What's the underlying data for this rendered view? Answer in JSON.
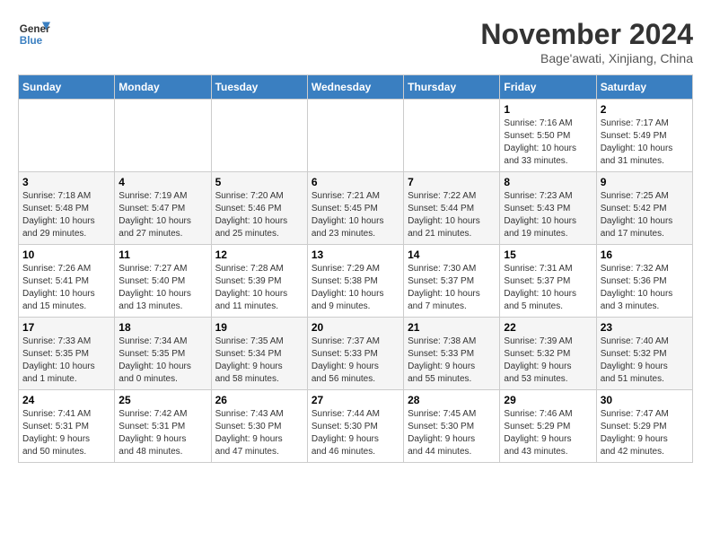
{
  "header": {
    "logo_line1": "General",
    "logo_line2": "Blue",
    "month_title": "November 2024",
    "location": "Bage'awati, Xinjiang, China"
  },
  "weekdays": [
    "Sunday",
    "Monday",
    "Tuesday",
    "Wednesday",
    "Thursday",
    "Friday",
    "Saturday"
  ],
  "weeks": [
    [
      {
        "day": "",
        "info": ""
      },
      {
        "day": "",
        "info": ""
      },
      {
        "day": "",
        "info": ""
      },
      {
        "day": "",
        "info": ""
      },
      {
        "day": "",
        "info": ""
      },
      {
        "day": "1",
        "info": "Sunrise: 7:16 AM\nSunset: 5:50 PM\nDaylight: 10 hours\nand 33 minutes."
      },
      {
        "day": "2",
        "info": "Sunrise: 7:17 AM\nSunset: 5:49 PM\nDaylight: 10 hours\nand 31 minutes."
      }
    ],
    [
      {
        "day": "3",
        "info": "Sunrise: 7:18 AM\nSunset: 5:48 PM\nDaylight: 10 hours\nand 29 minutes."
      },
      {
        "day": "4",
        "info": "Sunrise: 7:19 AM\nSunset: 5:47 PM\nDaylight: 10 hours\nand 27 minutes."
      },
      {
        "day": "5",
        "info": "Sunrise: 7:20 AM\nSunset: 5:46 PM\nDaylight: 10 hours\nand 25 minutes."
      },
      {
        "day": "6",
        "info": "Sunrise: 7:21 AM\nSunset: 5:45 PM\nDaylight: 10 hours\nand 23 minutes."
      },
      {
        "day": "7",
        "info": "Sunrise: 7:22 AM\nSunset: 5:44 PM\nDaylight: 10 hours\nand 21 minutes."
      },
      {
        "day": "8",
        "info": "Sunrise: 7:23 AM\nSunset: 5:43 PM\nDaylight: 10 hours\nand 19 minutes."
      },
      {
        "day": "9",
        "info": "Sunrise: 7:25 AM\nSunset: 5:42 PM\nDaylight: 10 hours\nand 17 minutes."
      }
    ],
    [
      {
        "day": "10",
        "info": "Sunrise: 7:26 AM\nSunset: 5:41 PM\nDaylight: 10 hours\nand 15 minutes."
      },
      {
        "day": "11",
        "info": "Sunrise: 7:27 AM\nSunset: 5:40 PM\nDaylight: 10 hours\nand 13 minutes."
      },
      {
        "day": "12",
        "info": "Sunrise: 7:28 AM\nSunset: 5:39 PM\nDaylight: 10 hours\nand 11 minutes."
      },
      {
        "day": "13",
        "info": "Sunrise: 7:29 AM\nSunset: 5:38 PM\nDaylight: 10 hours\nand 9 minutes."
      },
      {
        "day": "14",
        "info": "Sunrise: 7:30 AM\nSunset: 5:37 PM\nDaylight: 10 hours\nand 7 minutes."
      },
      {
        "day": "15",
        "info": "Sunrise: 7:31 AM\nSunset: 5:37 PM\nDaylight: 10 hours\nand 5 minutes."
      },
      {
        "day": "16",
        "info": "Sunrise: 7:32 AM\nSunset: 5:36 PM\nDaylight: 10 hours\nand 3 minutes."
      }
    ],
    [
      {
        "day": "17",
        "info": "Sunrise: 7:33 AM\nSunset: 5:35 PM\nDaylight: 10 hours\nand 1 minute."
      },
      {
        "day": "18",
        "info": "Sunrise: 7:34 AM\nSunset: 5:35 PM\nDaylight: 10 hours\nand 0 minutes."
      },
      {
        "day": "19",
        "info": "Sunrise: 7:35 AM\nSunset: 5:34 PM\nDaylight: 9 hours\nand 58 minutes."
      },
      {
        "day": "20",
        "info": "Sunrise: 7:37 AM\nSunset: 5:33 PM\nDaylight: 9 hours\nand 56 minutes."
      },
      {
        "day": "21",
        "info": "Sunrise: 7:38 AM\nSunset: 5:33 PM\nDaylight: 9 hours\nand 55 minutes."
      },
      {
        "day": "22",
        "info": "Sunrise: 7:39 AM\nSunset: 5:32 PM\nDaylight: 9 hours\nand 53 minutes."
      },
      {
        "day": "23",
        "info": "Sunrise: 7:40 AM\nSunset: 5:32 PM\nDaylight: 9 hours\nand 51 minutes."
      }
    ],
    [
      {
        "day": "24",
        "info": "Sunrise: 7:41 AM\nSunset: 5:31 PM\nDaylight: 9 hours\nand 50 minutes."
      },
      {
        "day": "25",
        "info": "Sunrise: 7:42 AM\nSunset: 5:31 PM\nDaylight: 9 hours\nand 48 minutes."
      },
      {
        "day": "26",
        "info": "Sunrise: 7:43 AM\nSunset: 5:30 PM\nDaylight: 9 hours\nand 47 minutes."
      },
      {
        "day": "27",
        "info": "Sunrise: 7:44 AM\nSunset: 5:30 PM\nDaylight: 9 hours\nand 46 minutes."
      },
      {
        "day": "28",
        "info": "Sunrise: 7:45 AM\nSunset: 5:30 PM\nDaylight: 9 hours\nand 44 minutes."
      },
      {
        "day": "29",
        "info": "Sunrise: 7:46 AM\nSunset: 5:29 PM\nDaylight: 9 hours\nand 43 minutes."
      },
      {
        "day": "30",
        "info": "Sunrise: 7:47 AM\nSunset: 5:29 PM\nDaylight: 9 hours\nand 42 minutes."
      }
    ]
  ]
}
